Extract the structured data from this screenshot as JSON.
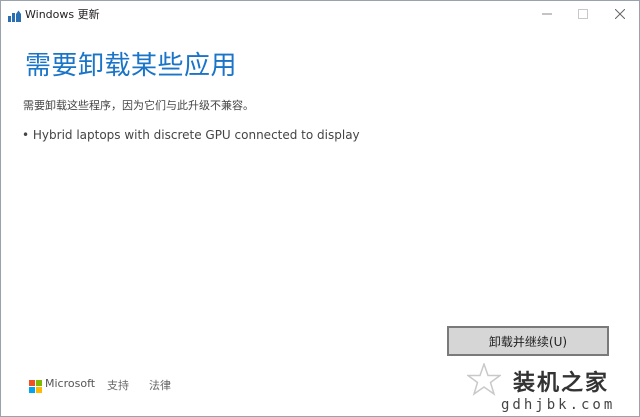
{
  "window": {
    "title": "Windows 更新",
    "icon": "windows-update-icon",
    "controls": {
      "minimize": "minimize-icon",
      "maximize": "maximize-icon",
      "close": "close-icon"
    }
  },
  "main": {
    "heading": "需要卸载某些应用",
    "description": "需要卸载这些程序，因为它们与此升级不兼容。",
    "apps": [
      "• Hybrid laptops with discrete GPU connected to display"
    ],
    "primary_button_label": "卸载并继续(U)"
  },
  "footer": {
    "brand": "Microsoft",
    "links": [
      "支持",
      "法律"
    ]
  },
  "watermark": {
    "title": "装机之家",
    "url": "gdhjbk.com"
  },
  "colors": {
    "heading": "#1a74c7",
    "button_bg": "#d6d6d6",
    "button_border": "#7a7a7a",
    "window_border": "#9aa3ab"
  }
}
